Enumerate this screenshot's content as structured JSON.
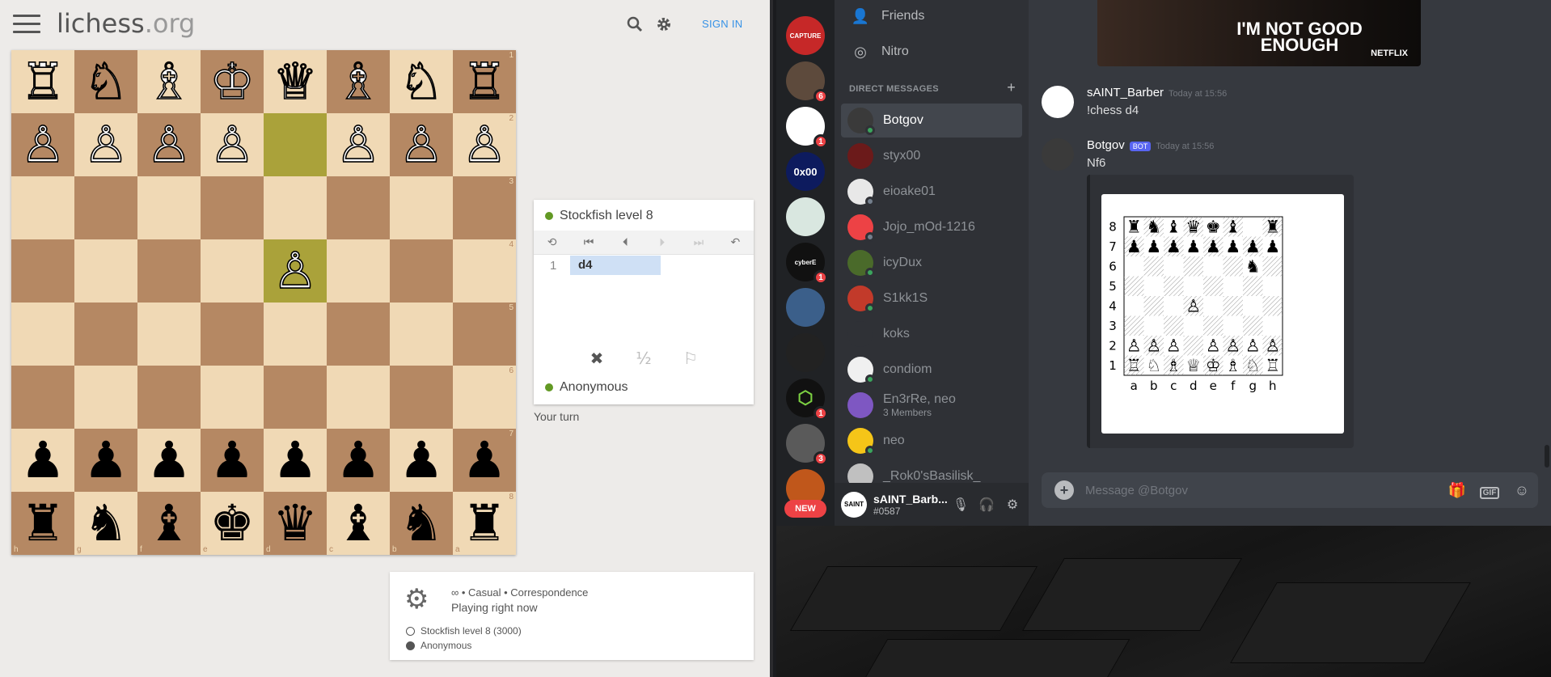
{
  "lichess": {
    "logo_main": "lichess",
    "logo_suffix": ".org",
    "sign_in": "SIGN IN",
    "board_flipped": true,
    "board_pieces": [
      [
        "♖",
        "♘",
        "♗",
        "♔",
        "♕",
        "♗",
        "♘",
        "♖"
      ],
      [
        "♙",
        "♙",
        "♙",
        "♙",
        "",
        "♙",
        "♙",
        "♙"
      ],
      [
        "",
        "",
        "",
        "",
        "",
        "",
        "",
        ""
      ],
      [
        "",
        "",
        "",
        "",
        "♙",
        "",
        "",
        ""
      ],
      [
        "",
        "",
        "",
        "",
        "",
        "",
        "",
        ""
      ],
      [
        "",
        "",
        "",
        "",
        "",
        "",
        "",
        ""
      ],
      [
        "♟",
        "♟",
        "♟",
        "♟",
        "♟",
        "♟",
        "♟",
        "♟"
      ],
      [
        "♜",
        "♞",
        "♝",
        "♚",
        "♛",
        "♝",
        "♞",
        "♜"
      ]
    ],
    "rank_labels": [
      "1",
      "2",
      "3",
      "4",
      "5",
      "6",
      "7",
      "8"
    ],
    "file_labels": [
      "h",
      "g",
      "f",
      "e",
      "d",
      "c",
      "b",
      "a"
    ],
    "highlight_squares": [
      [
        1,
        4
      ],
      [
        3,
        4
      ]
    ],
    "opponent_name": "Stockfish level 8",
    "player_name": "Anonymous",
    "move_number": "1",
    "move_white": "d4",
    "your_turn": "Your turn",
    "draw_label": "½",
    "game_info": {
      "line1": "∞ • Casual • Correspondence",
      "line2": "Playing right now",
      "white_player": "Stockfish level 8 (3000)",
      "black_player": "Anonymous"
    }
  },
  "discord": {
    "nav": [
      {
        "label": "Friends",
        "icon": "friends-icon"
      },
      {
        "label": "Nitro",
        "icon": "nitro-icon"
      }
    ],
    "dm_header": "DIRECT MESSAGES",
    "dms": [
      {
        "name": "Botgov",
        "sub": "",
        "status": "online",
        "color": "#3a3a3a",
        "selected": true
      },
      {
        "name": "styx00",
        "sub": "",
        "status": "none",
        "color": "#6b1a1a",
        "selected": false
      },
      {
        "name": "eioake01",
        "sub": "",
        "status": "offline",
        "color": "#e8e8e8",
        "selected": false
      },
      {
        "name": "Jojo_mOd-1216",
        "sub": "",
        "status": "offline",
        "color": "#ed4245",
        "selected": false
      },
      {
        "name": "icyDux",
        "sub": "",
        "status": "online",
        "color": "#4a6a2a",
        "selected": false
      },
      {
        "name": "S1kk1S",
        "sub": "",
        "status": "online",
        "color": "#c23a2a",
        "selected": false
      },
      {
        "name": "koks",
        "sub": "",
        "status": "none",
        "color": "#2f3136",
        "selected": false
      },
      {
        "name": "condiom",
        "sub": "",
        "status": "online",
        "color": "#f0f0f0",
        "selected": false
      },
      {
        "name": "En3rRe, neo",
        "sub": "3 Members",
        "status": "none",
        "color": "#7e57c2",
        "selected": false
      },
      {
        "name": "neo",
        "sub": "",
        "status": "online",
        "color": "#f5c518",
        "selected": false
      },
      {
        "name": "_Rok0'sBasilisk_",
        "sub": "",
        "status": "none",
        "color": "#c0c0c0",
        "selected": false
      }
    ],
    "guild_badges": {
      "g2": "6",
      "g3": "1",
      "g5": "1",
      "g8": "1",
      "g9": "3"
    },
    "guild_capture_text": "CAPTURE",
    "guild_0x00_text": "0x00",
    "guild_cyber_text": "cyberE",
    "new_pill": "NEW",
    "user": {
      "name": "sAINT_Barb...",
      "tag": "#0587"
    },
    "banner_text": "I'M NOT GOOD ENOUGH",
    "banner_brand": "NETFLIX",
    "messages": [
      {
        "author": "sAINT_Barber",
        "time": "Today at 15:56",
        "body": "!chess d4",
        "bot": false
      },
      {
        "author": "Botgov",
        "time": "Today at 15:56",
        "body": "Nf6",
        "bot": true,
        "bot_tag": "BOT"
      }
    ],
    "embed_board": {
      "rows": [
        [
          "♜",
          "♞",
          "♝",
          "♛",
          "♚",
          "♝",
          "",
          ""
        ],
        [
          "♟",
          "♟",
          "♟",
          "♟",
          "♟",
          "♟",
          "♟",
          "♟"
        ],
        [
          "",
          "",
          "",
          "",
          "",
          "",
          "♞",
          ""
        ],
        [
          "",
          "",
          "",
          "",
          "",
          "",
          "",
          ""
        ],
        [
          "",
          "",
          "",
          "♙",
          "",
          "",
          "",
          ""
        ],
        [
          "",
          "",
          "",
          "",
          "",
          "",
          "",
          ""
        ],
        [
          "♙",
          "♙",
          "♙",
          "",
          "♙",
          "♙",
          "♙",
          "♙"
        ],
        [
          "♖",
          "♘",
          "♗",
          "♕",
          "♔",
          "♗",
          "♘",
          "♖"
        ]
      ],
      "extra_rook_row0": "♜",
      "rank_labels": [
        "8",
        "7",
        "6",
        "5",
        "4",
        "3",
        "2",
        "1"
      ],
      "file_labels": [
        "a",
        "b",
        "c",
        "d",
        "e",
        "f",
        "g",
        "h"
      ]
    },
    "input_placeholder": "Message @Botgov"
  }
}
